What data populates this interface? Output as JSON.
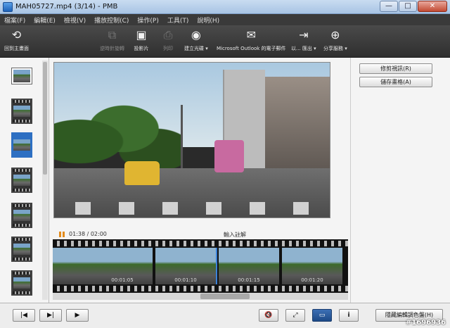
{
  "window": {
    "title": "MAH05727.mp4 (3/14) - PMB",
    "controls": [
      "—",
      "□",
      "✕"
    ]
  },
  "menu": [
    "檔案(F)",
    "編輯(E)",
    "檢視(V)",
    "播放控制(C)",
    "操作(P)",
    "工具(T)",
    "說明(H)"
  ],
  "toolbar": {
    "back": "回到主畫面",
    "rotate": "逆時針旋轉",
    "slideshow": "投影片",
    "print": "列印",
    "disc": "建立光碟",
    "email": "Microsoft Outlook 的電子郵件",
    "export": "以... 匯出",
    "share": "分享服務"
  },
  "playback": {
    "time": "01:38 / 02:00",
    "caption": "輸入註解"
  },
  "filmstrip": {
    "frames": [
      "",
      "00:01:05",
      "00:01:10",
      "00:01:15",
      "00:01:20"
    ],
    "selected_index": 2
  },
  "right": {
    "trim": "修剪視訊(R)",
    "save": "儲存畫格(A)"
  },
  "bottom": {
    "prev": "|◀",
    "next": "▶|",
    "play": "▶",
    "mute": "🔇",
    "fit": "⤢",
    "fullscreen": "▭",
    "info": "i",
    "hide": "隱藏編輯調色盤(H)"
  },
  "watermark": "#1696936",
  "colors": {
    "accent": "#2d6fc2",
    "pause": "#e38a1a"
  }
}
